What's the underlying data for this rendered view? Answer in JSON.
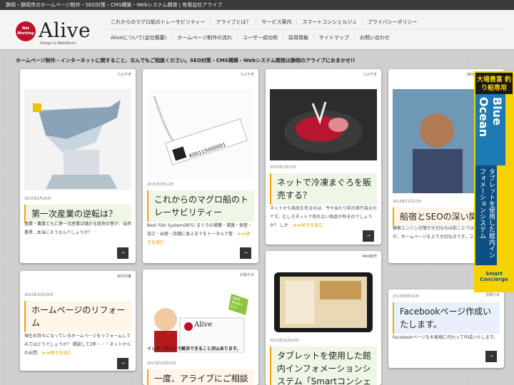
{
  "topbar": {
    "text": "静岡・静岡市のホームページ制作・SEO対策・CMS構築・Webシステム開発 | 有限会社アライブ"
  },
  "logo": {
    "badge_line1": "Net",
    "badge_line2": "Working",
    "word": "Alive",
    "subtitle": "Design & WebWorks"
  },
  "nav": {
    "row1": [
      "これからのマグロ船のトレーサビリティー",
      "アライブとは？",
      "サービス案内",
      "スマートコンシェルジュ",
      "プライバシーポリシー"
    ],
    "row2": [
      "Aliveについて(会社概要)",
      "ホームページ制作の流れ",
      "ユーザー成功例",
      "採用情報",
      "サイトマップ",
      "お問い合わせ"
    ]
  },
  "tagline": "ホームページ制作・インターネットに関すること、なんでもご相談ください。SEO対策・CMS構築・Webシステム開発は静岡のアライブにおまかせ!!",
  "cards": [
    {
      "tag": "つぶやき",
      "date": "2015年2月26日",
      "title": "第一次産業の逆転は？",
      "body": "漁業・農業ともに第一次産業は儲かる商売の筈が、当然業界...本当にそうなんでしょうか？",
      "more": "≫≫続きを読む",
      "arrow": "→"
    },
    {
      "tag": "つぶやき",
      "date": "2015年3月12日",
      "title": "これからのマグロ船のトレーサビリティー",
      "body": "Best Fish System(BFS) まぐろの捕獲・運搬・保管・加工・出荷・店舗に並ぶまでをトータルで管",
      "more": "≫≫続きを読む",
      "arrow": "→",
      "tag_text": "K00115000001"
    },
    {
      "tag": "つぶやき",
      "date": "2015年1月15日",
      "title": "ネットで冷凍まぐろを販売する？",
      "body": "ネットから商品を売るのは、今や当たり前の商行為なのです。むしろネットで売れない商品が有るのでしょうか？ しか",
      "more": "≫≫続きを読む",
      "arrow": "→"
    },
    {
      "tag": "SEO対策",
      "date": "2013年11月12日",
      "title": "船宿とSEOの深い関",
      "body": "検索エンジン対策が大切なのは前ことでは無いのですが、ホームページを上で大切な点です。ユー",
      "more": "",
      "arrow": "→"
    },
    {
      "tag": "SEO対策",
      "date": "2013年10月20日",
      "title": "ホームページのリフォーム",
      "body": "現在お持ちになっているホームページをリフォームしてみてはどうでしょうか？ 開設して2年・・・ネットからのお問",
      "more": "≫≫続きを読む",
      "arrow": "→"
    },
    {
      "tag": "お知らせ",
      "date": "2013年10月23日",
      "title": "一度、アライブにご相談",
      "body": "",
      "more": "",
      "arrow": "",
      "caption": "インターネットで解決できること沢山あります。",
      "ww_badge": "Web Works 2.0",
      "card_logo": "Alive"
    },
    {
      "tag": "Web制作",
      "date": "2013年10月24日",
      "title": "タブレットを使用した館内インフォメーションシステム「Smartコンシェル",
      "body": "",
      "more": "",
      "arrow": ""
    },
    {
      "tag": "お知らせ",
      "date": "2013年9月16日",
      "title": "Facebookページ作成いたします。",
      "body": "Facebookページをお客様に代わって作成いたします。",
      "more": "",
      "arrow": "→"
    }
  ],
  "banner": {
    "top": "大場豊富 釣り船専用",
    "mid": "Blue Ocean",
    "low": "タブレットを使用した館内インフォメーションシステム",
    "bottom": "Smart Concierge"
  }
}
